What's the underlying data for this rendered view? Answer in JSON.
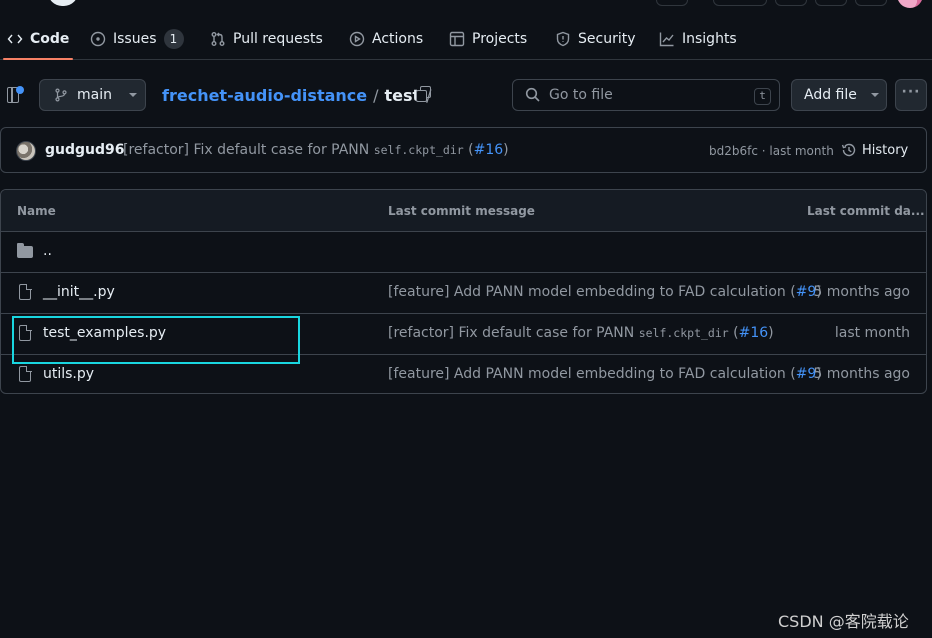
{
  "repo_nav": {
    "tabs": [
      {
        "label": "Code",
        "icon": "code-icon",
        "selected": true
      },
      {
        "label": "Issues",
        "icon": "issue-opened-icon",
        "counter": "1"
      },
      {
        "label": "Pull requests",
        "icon": "git-pull-request-icon"
      },
      {
        "label": "Actions",
        "icon": "play-icon"
      },
      {
        "label": "Projects",
        "icon": "table-icon"
      },
      {
        "label": "Security",
        "icon": "shield-icon"
      },
      {
        "label": "Insights",
        "icon": "graph-icon"
      }
    ]
  },
  "file_nav": {
    "branch": "main",
    "breadcrumb": {
      "repo": "frechet-audio-distance",
      "sep1": "/",
      "folder": "test",
      "sep2": "/"
    },
    "goto_placeholder": "Go to file",
    "goto_shortcut": "t",
    "add_file_label": "Add file",
    "more_label": "···"
  },
  "latest_commit": {
    "author": "gudgud96",
    "message_prefix": "[refactor] Fix default case for PANN",
    "message_code": "self.ckpt_dir",
    "message_open": "(",
    "pr": "#16",
    "message_close": ")",
    "sha_and_time": "bd2b6fc · last month",
    "history_label": "History"
  },
  "file_table": {
    "headers": {
      "name": "Name",
      "message": "Last commit message",
      "date": "Last commit da..."
    },
    "parent_dir": "..",
    "rows": [
      {
        "name": "__init__.py",
        "msg": "[feature] Add PANN model embedding to FAD calculation",
        "code": "",
        "pr": "#9",
        "date": "5 months ago"
      },
      {
        "name": "test_examples.py",
        "msg": "[refactor] Fix default case for PANN",
        "code": "self.ckpt_dir",
        "pr": "#16",
        "date": "last month"
      },
      {
        "name": "utils.py",
        "msg": "[feature] Add PANN model embedding to FAD calculation",
        "code": "",
        "pr": "#9",
        "date": "5 months ago"
      }
    ]
  },
  "colors": {
    "accent_link": "#4493f8",
    "tab_underline": "#f78166",
    "highlight_box": "#19d6e0",
    "background": "#0d1117"
  },
  "watermark": "CSDN @客院载论"
}
